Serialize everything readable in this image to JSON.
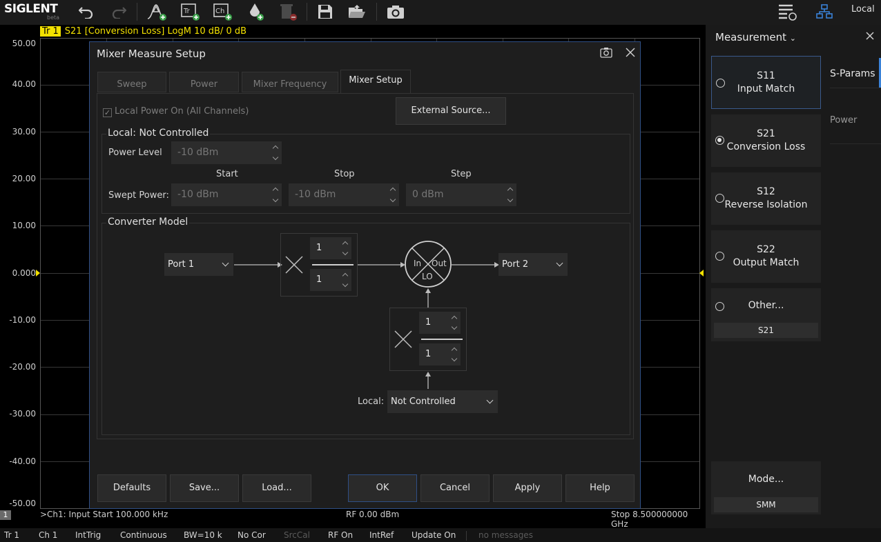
{
  "toolbar": {
    "logo": "SIGLENT",
    "logo_sub": "beta",
    "icons": [
      "undo-icon",
      "redo-icon",
      "add-trace-marker-icon",
      "add-trace-icon",
      "add-channel-icon",
      "add-ink-icon",
      "delete-icon",
      "save-icon",
      "open-folder-icon",
      "camera-icon",
      "layout-icon",
      "network-icon"
    ],
    "local": "Local"
  },
  "trace": {
    "badge": "Tr 1",
    "text": "S21 [Conversion Loss]  LogM  10 dB/  0 dB"
  },
  "plot": {
    "y_labels": [
      "50.00",
      "40.00",
      "30.00",
      "20.00",
      "10.00",
      "0.000",
      "-10.00",
      "-20.00",
      "-30.00",
      "-40.00",
      "-50.00"
    ]
  },
  "channel_footer": {
    "badge": "1",
    "start": ">Ch1: Input Start 100.000 kHz",
    "power": "RF 0.00 dBm",
    "stop": "Stop 8.500000000 GHz"
  },
  "status_bar": [
    "Tr 1",
    "Ch 1",
    "IntTrig",
    "Continuous",
    "BW=10 k",
    "No Cor",
    "SrcCal",
    "RF On",
    "IntRef",
    "Update On",
    "no messages"
  ],
  "side_panel": {
    "title": "Measurement",
    "buttons": [
      {
        "line1": "S11",
        "line2": "Input Match"
      },
      {
        "line1": "S21",
        "line2": "Conversion Loss"
      },
      {
        "line1": "S12",
        "line2": "Reverse Isolation"
      },
      {
        "line1": "S22",
        "line2": "Output Match"
      }
    ],
    "other": {
      "label": "Other...",
      "value": "S21"
    },
    "mode": {
      "label": "Mode...",
      "value": "SMM"
    },
    "tabs": [
      "S-Params",
      "Power"
    ]
  },
  "dialog": {
    "title": "Mixer Measure Setup",
    "tabs": [
      "Sweep",
      "Power",
      "Mixer Frequency",
      "Mixer Setup"
    ],
    "local_power_on": "Local Power On (All Channels)",
    "external_source": "External Source...",
    "local_group": {
      "title": "Local: Not Controlled",
      "power_level_label": "Power Level",
      "power_level": "-10 dBm",
      "start_head": "Start",
      "stop_head": "Stop",
      "step_head": "Step",
      "swept_label": "Swept Power:",
      "start": "-10 dBm",
      "stop": "-10 dBm",
      "step": "0 dBm"
    },
    "converter": {
      "title": "Converter Model",
      "input_port": "Port 1",
      "output_port": "Port 2",
      "in_num": "1",
      "in_den": "1",
      "lo_num": "1",
      "lo_den": "1",
      "mixer_in": "In",
      "mixer_out": "Out",
      "mixer_lo": "LO",
      "local_label": "Local:",
      "local_value": "Not Controlled"
    },
    "buttons": [
      "Defaults",
      "Save...",
      "Load...",
      "OK",
      "Cancel",
      "Apply",
      "Help"
    ]
  }
}
